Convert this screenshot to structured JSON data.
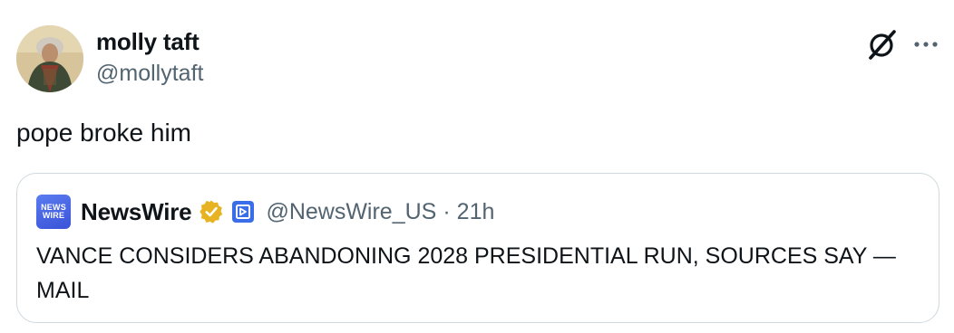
{
  "author": {
    "display_name": "molly taft",
    "handle": "@mollytaft"
  },
  "tweet": {
    "text": "pope broke him"
  },
  "icons": {
    "grok": "grok-icon",
    "more": "more-horizontal-icon",
    "verified": "verified-badge-icon",
    "affiliate": "affiliate-badge-icon"
  },
  "quoted": {
    "logo_line1": "NEWS",
    "logo_line2": "WIRE",
    "display_name": "NewsWire",
    "handle": "@NewsWire_US",
    "separator": "·",
    "time": "21h",
    "text": "VANCE CONSIDERS ABANDONING 2028 PRESIDENTIAL RUN, SOURCES SAY — MAIL"
  },
  "colors": {
    "text_primary": "#0f1419",
    "text_secondary": "#536471",
    "border": "#cfd9de",
    "verified_gold": "#e8b322",
    "brand_blue": "#3a52d8"
  }
}
